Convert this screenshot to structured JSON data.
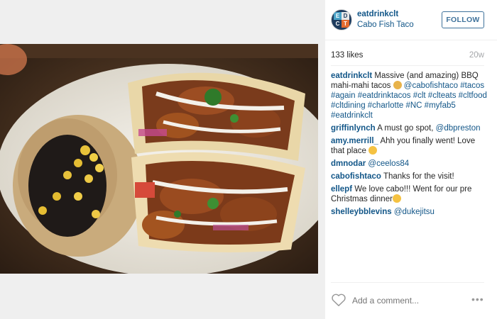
{
  "post": {
    "username": "eatdrinkclt",
    "location": "Cabo Fish Taco",
    "follow_label": "FOLLOW",
    "likes": "133 likes",
    "age": "20w"
  },
  "caption": {
    "user": "eatdrinkclt",
    "text_before": "Massive (and amazing) BBQ mahi-mahi tacos",
    "mention": "@cabofishtaco",
    "hashtags": "#tacos #again #eatdrinktacos #clt #clteats #cltfood #cltdining #charlotte #NC #myfab5 #eatdrinkclt"
  },
  "comments": [
    {
      "user": "griffinlynch",
      "text": "A must go spot, ",
      "link": "@dbpreston"
    },
    {
      "user": "amy.merrill_",
      "text": "Ahh you finally went! Love that place",
      "link": ""
    },
    {
      "user": "dmnodar",
      "text": "",
      "link": "@ceelos84"
    },
    {
      "user": "cabofishtaco",
      "text": "Thanks for the visit!",
      "link": ""
    },
    {
      "user": "ellepf",
      "text": "We love cabo!!! Went for our pre Christmas dinner",
      "link": ""
    },
    {
      "user": "shelleybblevins",
      "text": "",
      "link": "@dukejitsu"
    }
  ],
  "footer": {
    "add_comment_placeholder": "Add a comment...",
    "more_label": "•••"
  },
  "icons": {
    "heart": "heart-icon",
    "more": "more-options-icon",
    "emoji_taco": "taco-emoji",
    "emoji_smile": "smile-emoji"
  },
  "colors": {
    "link": "#125688",
    "follow": "#3f729b",
    "muted": "#a5a7aa"
  }
}
